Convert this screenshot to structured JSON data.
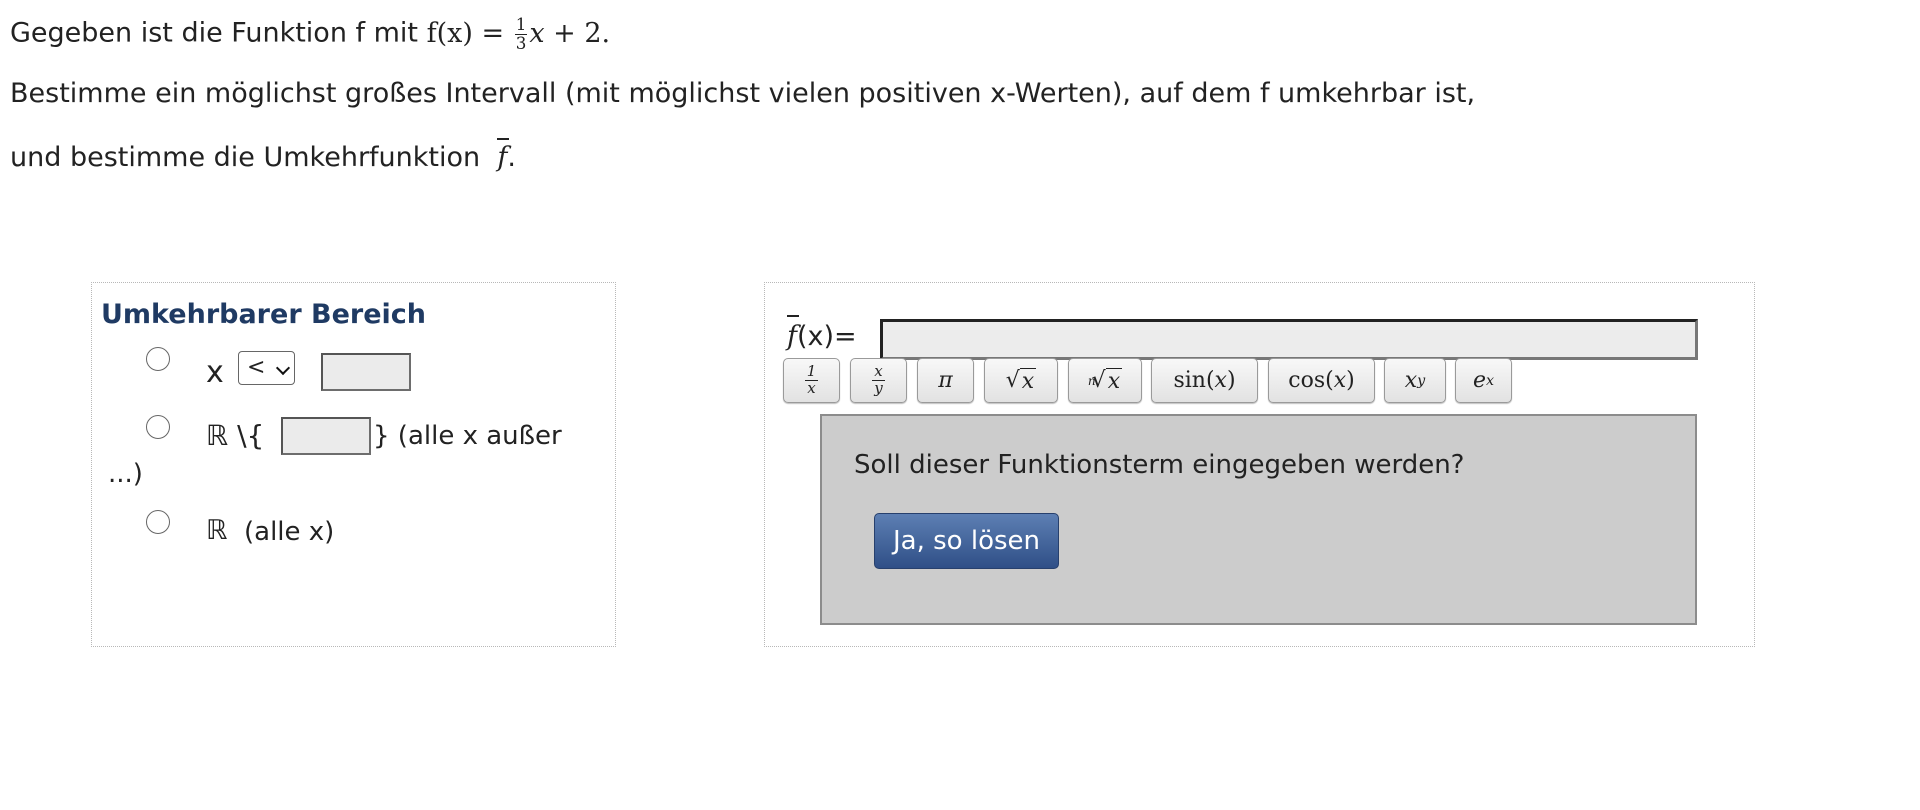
{
  "task": {
    "line1_prefix": "Gegeben ist die Funktion f mit ",
    "func_name": "f(x)",
    "equals": "=",
    "frac_num": "1",
    "frac_den": "3",
    "term_var": "x",
    "term_rest": "+ 2.",
    "line2": "Bestimme ein möglichst großes Intervall (mit möglichst vielen positiven x-Werten), auf dem f umkehrbar ist,",
    "line3_prefix": "und bestimme die Umkehrfunktion",
    "inverse_symbol": "f",
    "line3_suffix": "."
  },
  "range_panel": {
    "title": "Umkehrbarer Bereich",
    "option1": {
      "label": "x",
      "select_value": "<"
    },
    "option2": {
      "label_prefix": "ℝ \\{",
      "label_suffix": "}  (alle x außer",
      "label_wrap": "...)"
    },
    "option3": {
      "symbol": "ℝ",
      "label": "(alle x)"
    }
  },
  "function_panel": {
    "input_prefix_symbol": "f",
    "input_prefix": "(x)=",
    "keyboard": [
      {
        "id": "frac1x",
        "num": "1",
        "den": "x"
      },
      {
        "id": "fracxy",
        "num": "x",
        "den": "y"
      },
      {
        "id": "pi",
        "label": "π"
      },
      {
        "id": "sqrt",
        "radicand": "x"
      },
      {
        "id": "nroot",
        "index": "n",
        "radicand": "x"
      },
      {
        "id": "sin",
        "label": "sin(",
        "arg": "x",
        "close": ")"
      },
      {
        "id": "cos",
        "label": "cos(",
        "arg": "x",
        "close": ")"
      },
      {
        "id": "power",
        "base": "x",
        "exp": "y"
      },
      {
        "id": "exp",
        "base": "e",
        "exp": "x"
      }
    ],
    "confirm": {
      "question": "Soll dieser Funktionsterm eingegeben werden?",
      "button": "Ja, so lösen",
      "button_color": "#3e5f97",
      "panel_color": "#cccccc"
    }
  },
  "colors": {
    "title": "#1f3a63"
  }
}
